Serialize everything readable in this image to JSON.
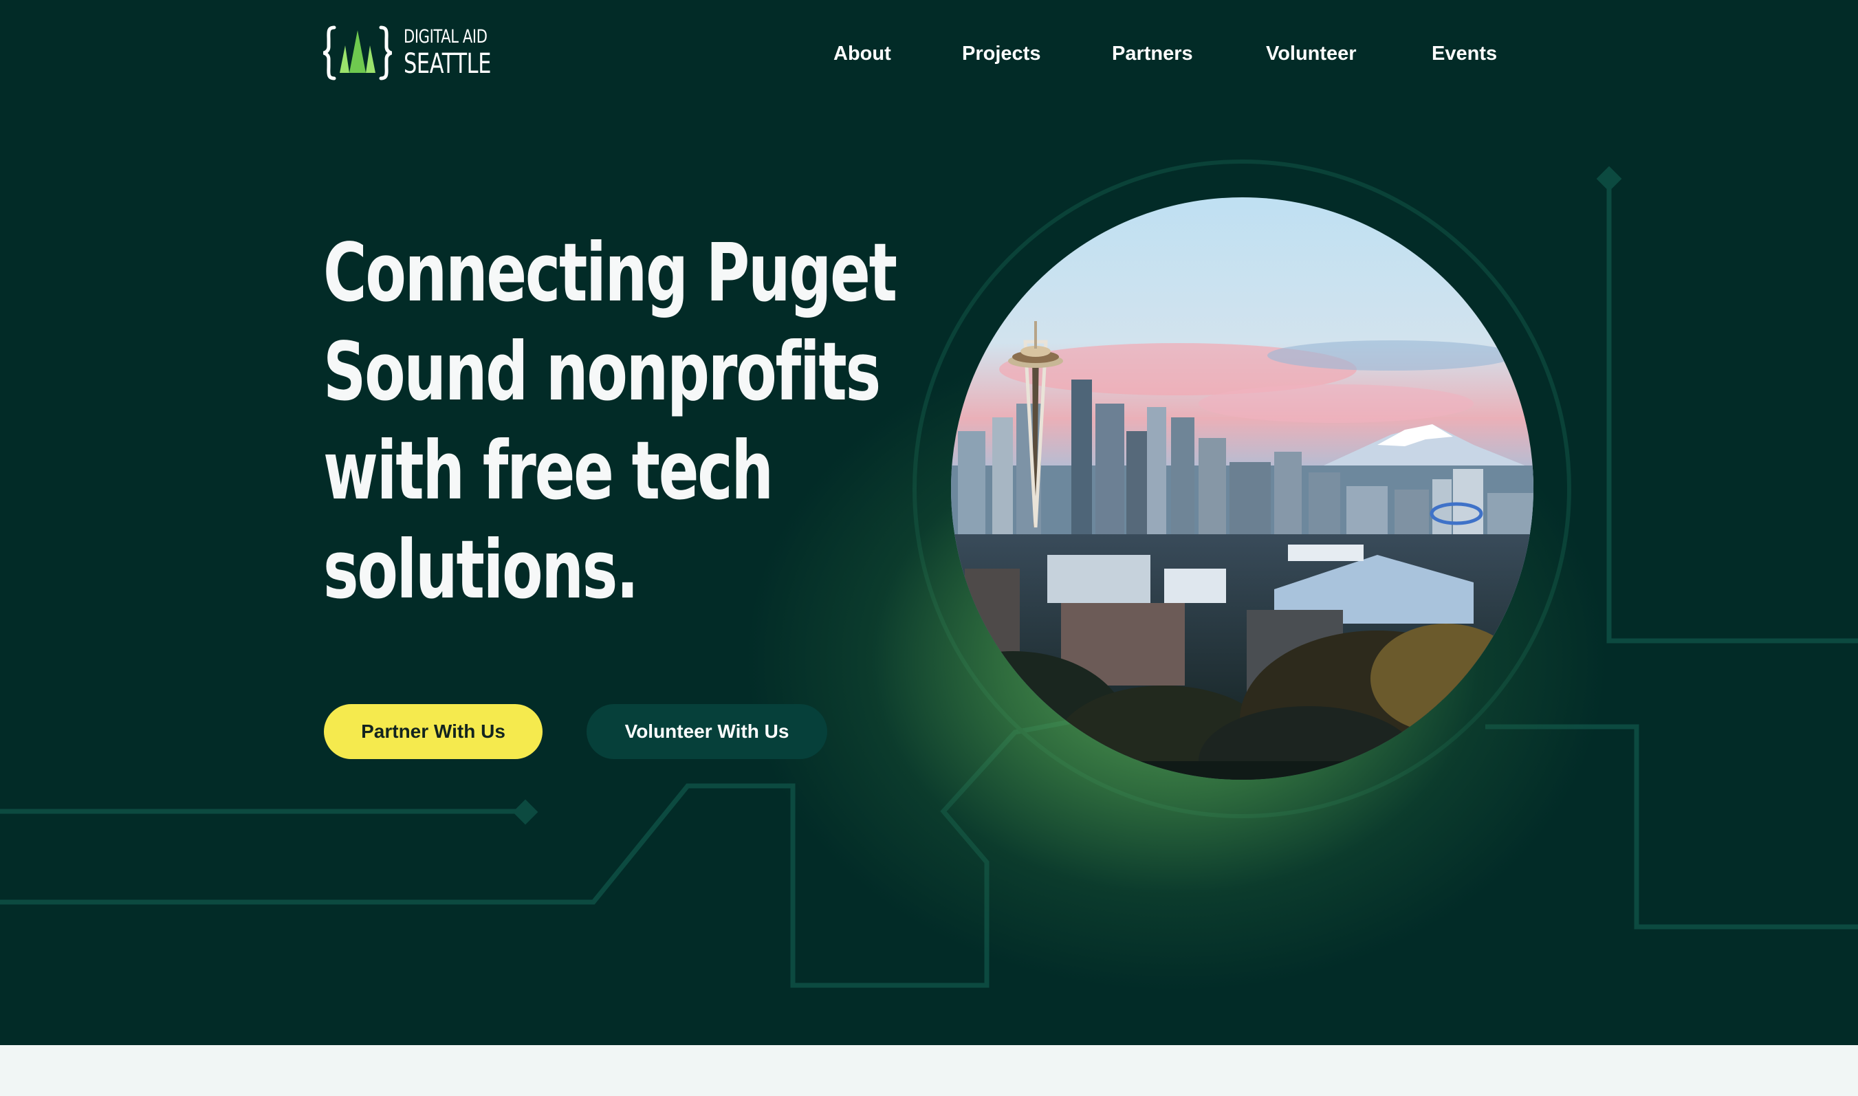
{
  "header": {
    "logo": {
      "line1": "DIGITAL AID",
      "line2": "SEATTLE",
      "icon": "tree-braces-logo-icon"
    },
    "nav": [
      {
        "label": "About"
      },
      {
        "label": "Projects"
      },
      {
        "label": "Partners"
      },
      {
        "label": "Volunteer"
      },
      {
        "label": "Events"
      }
    ]
  },
  "hero": {
    "headline_lines": [
      "Connecting Puget",
      "Sound nonprofits",
      "with free tech",
      "solutions."
    ],
    "buttons": {
      "partner": "Partner With Us",
      "volunteer": "Volunteer With Us"
    },
    "image": {
      "subject": "Seattle skyline with Space Needle and Mount Rainier"
    }
  },
  "colors": {
    "hero_background": "#022b27",
    "accent_yellow": "#f5ea4e",
    "secondary_button": "#06403a",
    "logo_green": "#7fd35a",
    "circuit_line": "#0c4a40",
    "page_background": "#f1f6f5"
  }
}
